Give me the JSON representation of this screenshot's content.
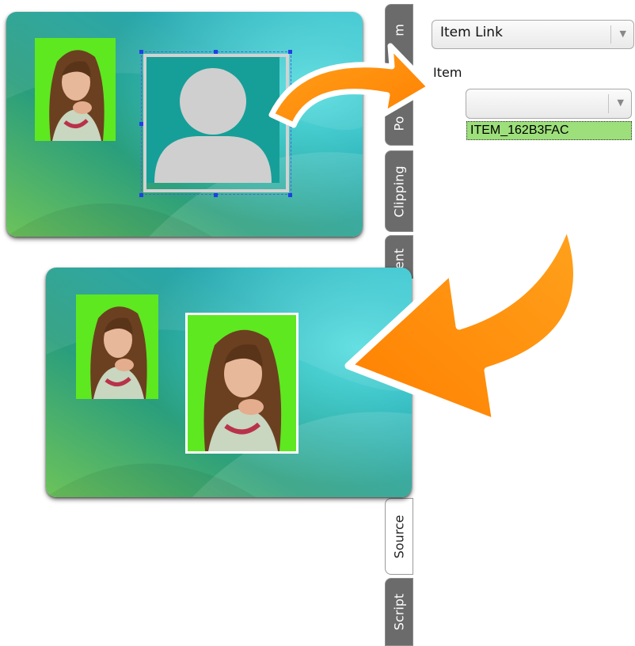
{
  "panel": {
    "tabs": [
      {
        "label": "m"
      },
      {
        "label": "Po"
      },
      {
        "label": "Clipping"
      },
      {
        "label": "ent"
      },
      {
        "label": "Source"
      },
      {
        "label": "Script"
      }
    ],
    "link_dropdown": {
      "value": "Item Link"
    },
    "item_label": "Item",
    "item_dropdown": {
      "value": ""
    },
    "item_option": "ITEM_162B3FAC"
  },
  "colors": {
    "photo_bg": "#5de820",
    "arrow": "#ff8a00",
    "card_teal": "#1aa3a8",
    "selection_handles": "#1f3fe6"
  }
}
